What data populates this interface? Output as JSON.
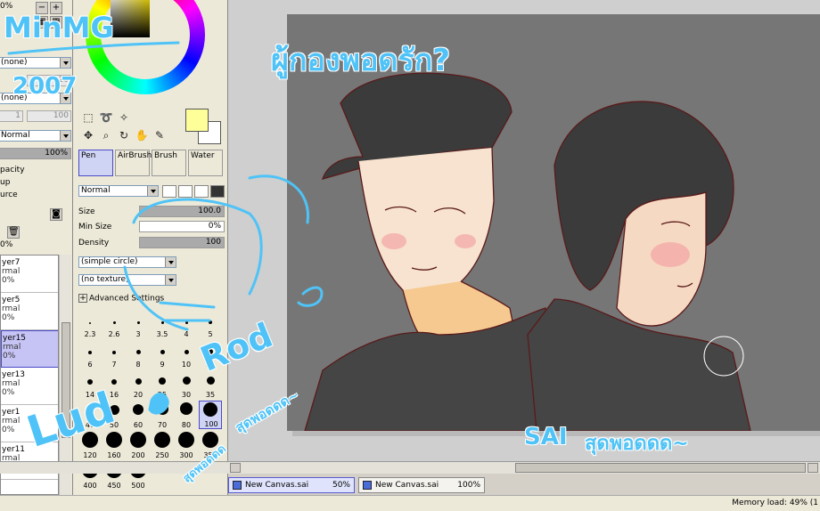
{
  "left_panel": {
    "top_value": "0%",
    "combo1": "(none)",
    "combo2": "(none)",
    "num1": "1",
    "num2": "100",
    "blend_mode": "Normal",
    "opacity": "100%",
    "opacity_label": "pacity",
    "group_label": "up",
    "source_label": "urce",
    "layers": [
      {
        "name": "yer7",
        "mode": "rmal",
        "opacity": "0%"
      },
      {
        "name": "yer5",
        "mode": "rmal",
        "opacity": "0%"
      },
      {
        "name": "yer15",
        "mode": "rmal",
        "opacity": "0%"
      },
      {
        "name": "yer13",
        "mode": "rmal",
        "opacity": "0%"
      },
      {
        "name": "yer1",
        "mode": "rmal",
        "opacity": "0%"
      },
      {
        "name": "yer11",
        "mode": "rmal",
        "opacity": "0%"
      }
    ],
    "top_layer_opacity": "0%"
  },
  "tool_panel": {
    "brush_tabs": [
      "Pen",
      "AirBrush",
      "Brush",
      "Water"
    ],
    "blend_mode": "Normal",
    "size_label": "Size",
    "size_value": "100.0",
    "size_prefix": "1.0",
    "min_size_label": "Min Size",
    "min_size_value": "0%",
    "density_label": "Density",
    "density_value": "100",
    "shape_combo": "(simple circle)",
    "texture_combo": "(no texture)",
    "advanced_label": "Advanced Settings",
    "dot_sizes": [
      "2.3",
      "2.6",
      "3",
      "3.5",
      "4",
      "5",
      "6",
      "7",
      "8",
      "9",
      "10",
      "12",
      "14",
      "16",
      "20",
      "25",
      "30",
      "35",
      "40",
      "50",
      "60",
      "70",
      "80",
      "100",
      "120",
      "160",
      "200",
      "250",
      "300",
      "350",
      "400",
      "450",
      "500"
    ],
    "selected_dot": "100"
  },
  "doc_tabs": [
    {
      "title": "New Canvas.sai",
      "zoom": "50%"
    },
    {
      "title": "New Canvas.sai",
      "zoom": "100%"
    }
  ],
  "status": {
    "memory": "Memory load: 49% (1"
  },
  "overlay": {
    "signature": "MinMG",
    "year": "2007",
    "headline_thai": "ผู้กองพอดรัก?",
    "name_left": "Lud",
    "name_right": "Rod",
    "thai_small_1": "สุดพอดดด~",
    "thai_small_2": "สุดพอดดด",
    "footer_sai": "SAI",
    "footer_thai": "สุดพอดดด~"
  },
  "colors": {
    "accent_doodle": "#4fc3f7",
    "foreground_swatch": "#ffff99",
    "canvas_bg": "#767676",
    "line_art": "#5a1a1a"
  }
}
